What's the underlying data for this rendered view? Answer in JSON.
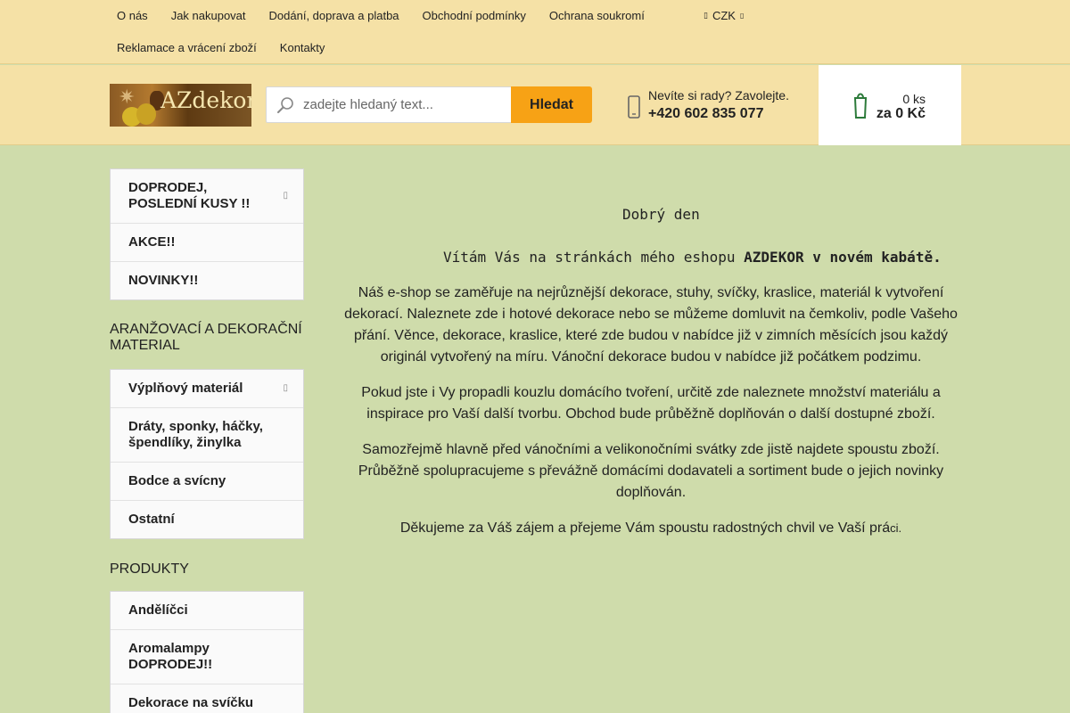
{
  "topnav": {
    "links": [
      "O nás",
      "Jak nakupovat",
      "Dodání, doprava a platba",
      "Obchodní podmínky",
      "Ochrana soukromí",
      "Reklamace a vrácení zboží",
      "Kontakty"
    ],
    "currency": "CZK"
  },
  "header": {
    "logo_text": "AZdekor",
    "search_placeholder": "zadejte hledaný text...",
    "search_button": "Hledat",
    "contact_question": "Nevíte si rady? Zavolejte.",
    "contact_phone": "+420 602 835 077",
    "cart_count": "0 ks",
    "cart_sum": "za 0 Kč"
  },
  "sidebar": {
    "top_menu": [
      {
        "label": "DOPRODEJ, POSLEDNÍ KUSY !!",
        "has_submenu": true
      },
      {
        "label": "AKCE!!",
        "has_submenu": false
      },
      {
        "label": "NOVINKY!!",
        "has_submenu": false
      }
    ],
    "heading_deco": "ARANŽOVACÍ A DEKORAČNÍ MATERIAL",
    "deco_menu": [
      {
        "label": "Výplňový materiál",
        "has_submenu": true
      },
      {
        "label": "Dráty, sponky, háčky, špendlíky, žinylka",
        "has_submenu": false
      },
      {
        "label": "Bodce a svícny",
        "has_submenu": false
      },
      {
        "label": "Ostatní",
        "has_submenu": false
      }
    ],
    "heading_products": "PRODUKTY",
    "products_menu": [
      {
        "label": "Andělíčci",
        "has_submenu": false
      },
      {
        "label": "Aromalampy DOPRODEJ!!",
        "has_submenu": false
      },
      {
        "label": "Dekorace na svíčku",
        "has_submenu": false
      }
    ]
  },
  "main": {
    "greeting": "Dobrý den",
    "welcome_text": "Vítám Vás na stránkách mého eshopu ",
    "welcome_bold": "AZDEKOR v novém kabátě.",
    "para1": "Náš e-shop se zaměřuje na nejrůznější dekorace, stuhy, svíčky, kraslice, materiál k vytvoření dekorací. Naleznete zde i hotové dekorace nebo se můžeme domluvit na čemkoliv, podle Vašeho přání. Věnce, dekorace, kraslice, které zde budou v nabídce již v zimních měsících jsou každý originál vytvořený na míru. Vánoční dekorace budou v nabídce již počátkem podzimu.",
    "para2": "Pokud jste i Vy propadli kouzlu domácího tvoření, určitě zde naleznete množství materiálu a inspirace pro Vaší další tvorbu. Obchod bude průběžně doplňován o další dostupné zboží.",
    "para3": "Samozřejmě hlavně před vánočními a velikonočními svátky zde jistě najdete  spoustu zboží. Průběžně spolupracujeme s převážně domácími dodavateli a sortiment bude o jejich novinky doplňován.",
    "para4_main": "Děkujeme za Váš zájem a přejeme Vám spoustu radostných chvil ve Vaší prá",
    "para4_tail": "ci."
  },
  "icons": {
    "search": "magnifier-icon",
    "phone": "phone-icon",
    "cart": "cart-icon",
    "currency": "currency-icon",
    "submenu": "chevron-right-icon"
  },
  "colors": {
    "header_bg": "#f5e1a6",
    "page_bg": "#cfdcab",
    "accent_button": "#f7a215",
    "cart_bg": "#ffffff"
  }
}
